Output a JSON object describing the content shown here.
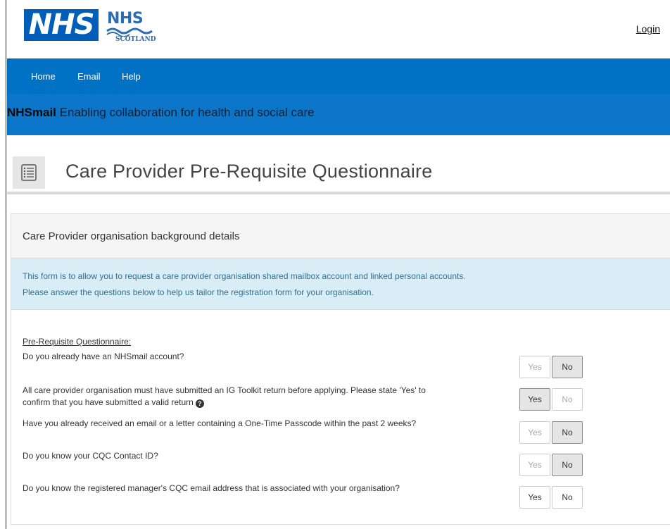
{
  "header": {
    "logo_nhs": "NHS",
    "logo_scot_top": "NHS",
    "logo_scot_bottom": "SCOTLAND",
    "login": "Login"
  },
  "nav": {
    "items": [
      {
        "label": "Home"
      },
      {
        "label": "Email"
      },
      {
        "label": "Help"
      }
    ]
  },
  "banner": {
    "brand": "NHSmail",
    "tagline": "Enabling collaboration for health and social care"
  },
  "page": {
    "title": "Care Provider Pre-Requisite Questionnaire",
    "icon": "form-list-icon"
  },
  "panel": {
    "heading": "Care Provider organisation background details",
    "info_line1": "This form is to allow you to request a care provider organisation shared mailbox account and linked personal accounts.",
    "info_line2": "Please answer the questions below to help us tailor the registration form for your organisation.",
    "questionnaire_heading": "Pre-Requisite Questionnaire:",
    "yes_label": "Yes",
    "no_label": "No",
    "questions": [
      {
        "text": "Do you already have an NHSmail account?",
        "selected": "No"
      },
      {
        "text": "All care provider organisation must have submitted an IG Toolkit return before applying. Please state 'Yes' to",
        "text2": "confirm that you have submitted a valid return",
        "selected": "Yes"
      },
      {
        "text": "Have you already received an email or a letter containing a One-Time Passcode within the past 2 weeks?",
        "selected": "No"
      },
      {
        "text": "Do you know your CQC Contact ID?",
        "selected": "No"
      },
      {
        "text": "Do you know the registered manager's CQC email address that is associated with your organisation?",
        "selected": ""
      }
    ]
  },
  "colors": {
    "nav_bg": "#0072c6",
    "banner_bg": "#0b76c9",
    "info_bg": "#d9edf7",
    "nhs_blue": "#005eb8"
  }
}
